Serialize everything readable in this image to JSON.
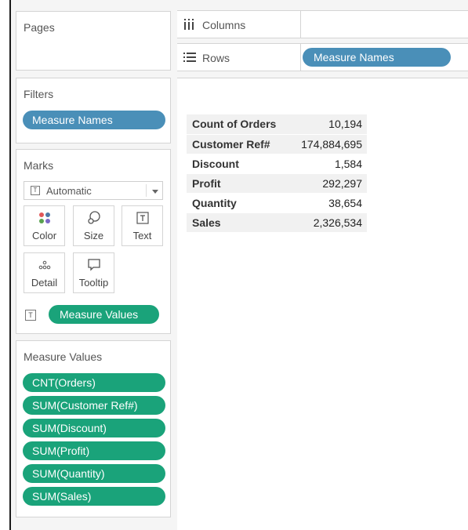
{
  "pages": {
    "title": "Pages"
  },
  "columns_shelf": {
    "label": "Columns",
    "icon": "columns-icon"
  },
  "rows_shelf": {
    "label": "Rows",
    "icon": "rows-icon",
    "pill": "Measure Names"
  },
  "filters": {
    "title": "Filters",
    "pill": "Measure Names"
  },
  "marks": {
    "title": "Marks",
    "type_selected": "Automatic",
    "buttons": [
      {
        "label": "Color",
        "icon": "color-icon"
      },
      {
        "label": "Size",
        "icon": "size-icon"
      },
      {
        "label": "Text",
        "icon": "text-icon"
      },
      {
        "label": "Detail",
        "icon": "detail-icon"
      },
      {
        "label": "Tooltip",
        "icon": "tooltip-icon"
      }
    ],
    "text_pill": "Measure Values"
  },
  "measure_values": {
    "title": "Measure Values",
    "pills": [
      "CNT(Orders)",
      "SUM(Customer Ref#)",
      "SUM(Discount)",
      "SUM(Profit)",
      "SUM(Quantity)",
      "SUM(Sales)"
    ]
  },
  "table": {
    "rows": [
      {
        "name": "Count of Orders",
        "value": "10,194"
      },
      {
        "name": "Customer Ref#",
        "value": "174,884,695"
      },
      {
        "name": "Discount",
        "value": "1,584"
      },
      {
        "name": "Profit",
        "value": "292,297"
      },
      {
        "name": "Quantity",
        "value": "38,654"
      },
      {
        "name": "Sales",
        "value": "2,326,534"
      }
    ]
  },
  "colors": {
    "blue_pill": "#4a8fb8",
    "green_pill": "#1aa37a"
  }
}
